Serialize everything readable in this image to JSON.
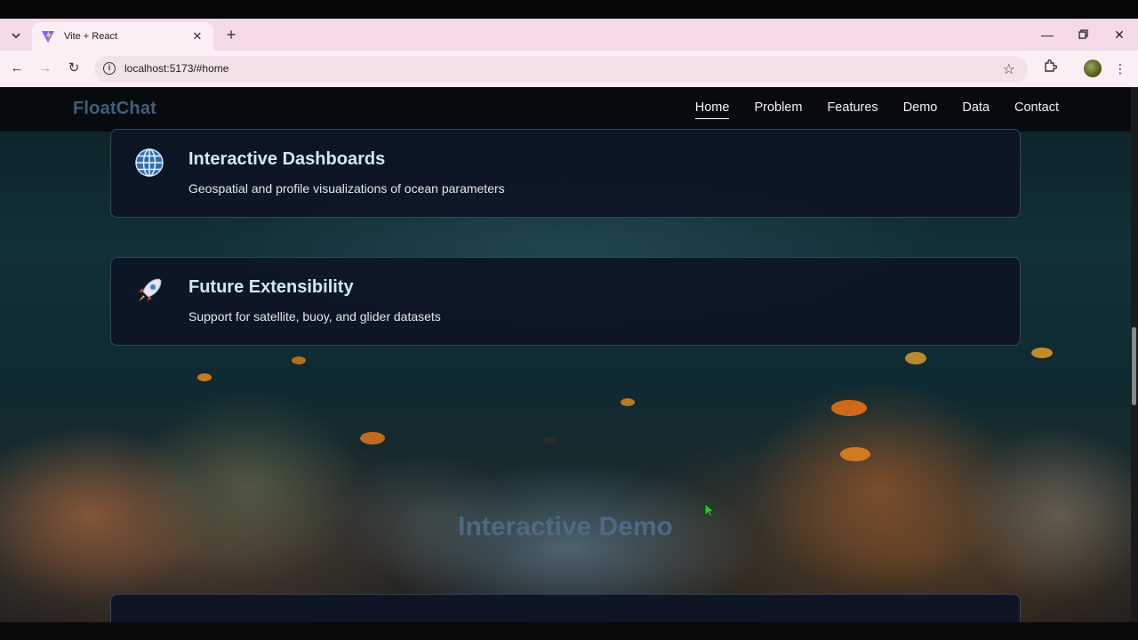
{
  "browser": {
    "tab_title": "Vite + React",
    "url": "localhost:5173/#home"
  },
  "site": {
    "brand": "FloatChat",
    "nav": [
      "Home",
      "Problem",
      "Features",
      "Demo",
      "Data",
      "Contact"
    ],
    "active_nav": "Home"
  },
  "cards": [
    {
      "icon": "globe-icon",
      "title": "Interactive Dashboards",
      "description": "Geospatial and profile visualizations of ocean parameters"
    },
    {
      "icon": "rocket-icon",
      "title": "Future Extensibility",
      "description": "Support for satellite, buoy, and glider datasets"
    }
  ],
  "section": {
    "title": "Interactive Demo"
  }
}
